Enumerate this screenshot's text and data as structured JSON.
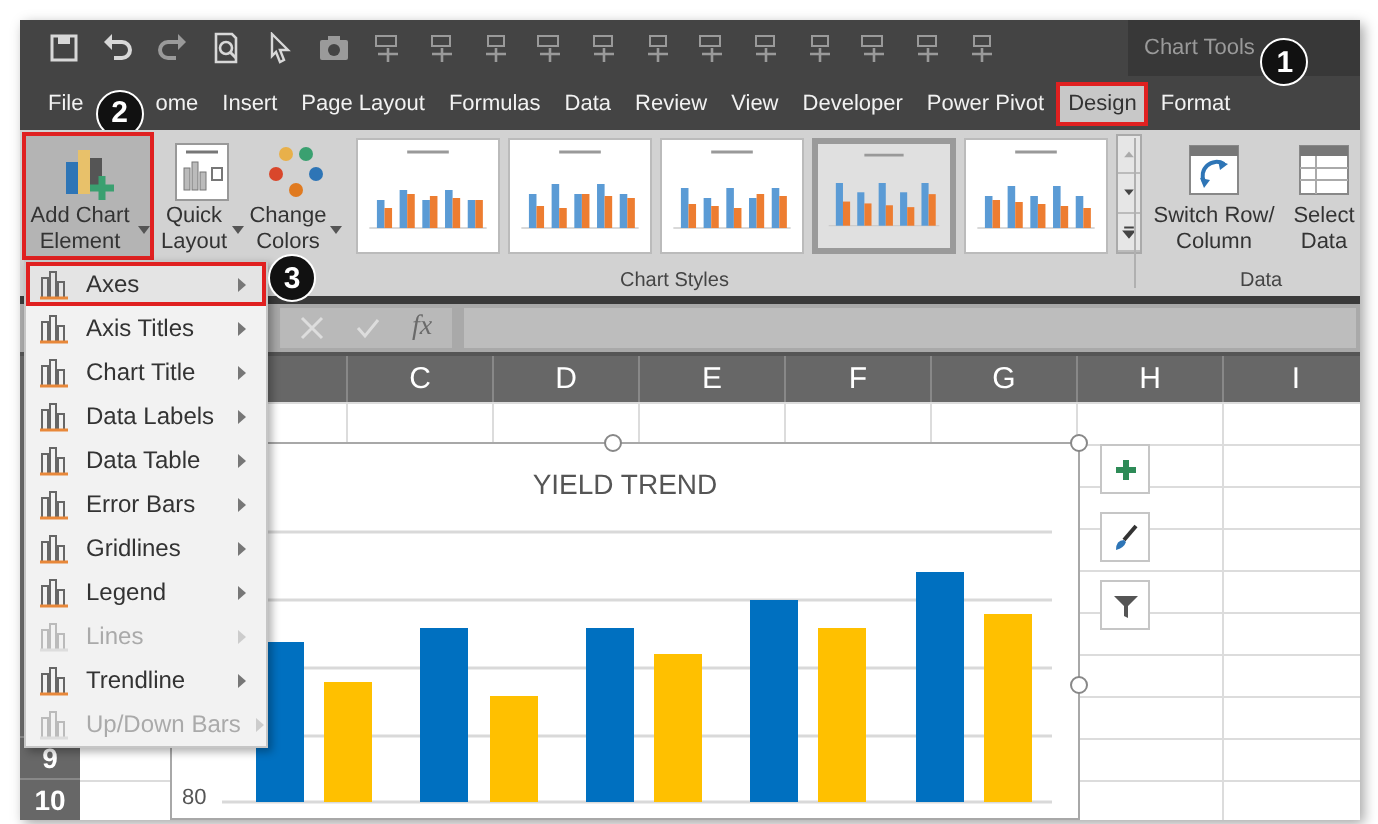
{
  "quick_access_toolbar": {
    "contextual_title": "Chart Tools"
  },
  "tabs": [
    {
      "label": "File",
      "selected": false
    },
    {
      "label": "ome",
      "selected": false
    },
    {
      "label": "Insert",
      "selected": false
    },
    {
      "label": "Page Layout",
      "selected": false
    },
    {
      "label": "Formulas",
      "selected": false
    },
    {
      "label": "Data",
      "selected": false
    },
    {
      "label": "Review",
      "selected": false
    },
    {
      "label": "View",
      "selected": false
    },
    {
      "label": "Developer",
      "selected": false
    },
    {
      "label": "Power Pivot",
      "selected": false
    },
    {
      "label": "Design",
      "selected": true
    },
    {
      "label": "Format",
      "selected": false
    }
  ],
  "ribbon": {
    "chart_layouts": [
      {
        "label": "Add Chart Element",
        "highlighted": true
      },
      {
        "label": "Quick Layout",
        "highlighted": false
      },
      {
        "label": "Change Colors",
        "highlighted": false
      }
    ],
    "chart_styles": {
      "group_label": "Chart Styles"
    },
    "data_group": {
      "buttons": [
        {
          "label": "Switch Row/ Column"
        },
        {
          "label": "Select Data"
        }
      ],
      "group_label": "Data"
    }
  },
  "formula_bar": {
    "function_label": "fx"
  },
  "columns": [
    "C",
    "D",
    "E",
    "F",
    "G",
    "H",
    "I"
  ],
  "rows": [
    "9",
    "10"
  ],
  "menu": {
    "items": [
      {
        "label": "Axes",
        "selected": true,
        "disabled": false
      },
      {
        "label": "Axis Titles",
        "selected": false,
        "disabled": false
      },
      {
        "label": "Chart Title",
        "selected": false,
        "disabled": false
      },
      {
        "label": "Data Labels",
        "selected": false,
        "disabled": false
      },
      {
        "label": "Data Table",
        "selected": false,
        "disabled": false
      },
      {
        "label": "Error Bars",
        "selected": false,
        "disabled": false
      },
      {
        "label": "Gridlines",
        "selected": false,
        "disabled": false
      },
      {
        "label": "Legend",
        "selected": false,
        "disabled": false
      },
      {
        "label": "Lines",
        "selected": false,
        "disabled": true
      },
      {
        "label": "Trendline",
        "selected": false,
        "disabled": false
      },
      {
        "label": "Up/Down Bars",
        "selected": false,
        "disabled": true
      }
    ]
  },
  "chart": {
    "title": "YIELD TREND",
    "axis_label": "80"
  },
  "callouts": [
    "1",
    "2",
    "3"
  ]
}
